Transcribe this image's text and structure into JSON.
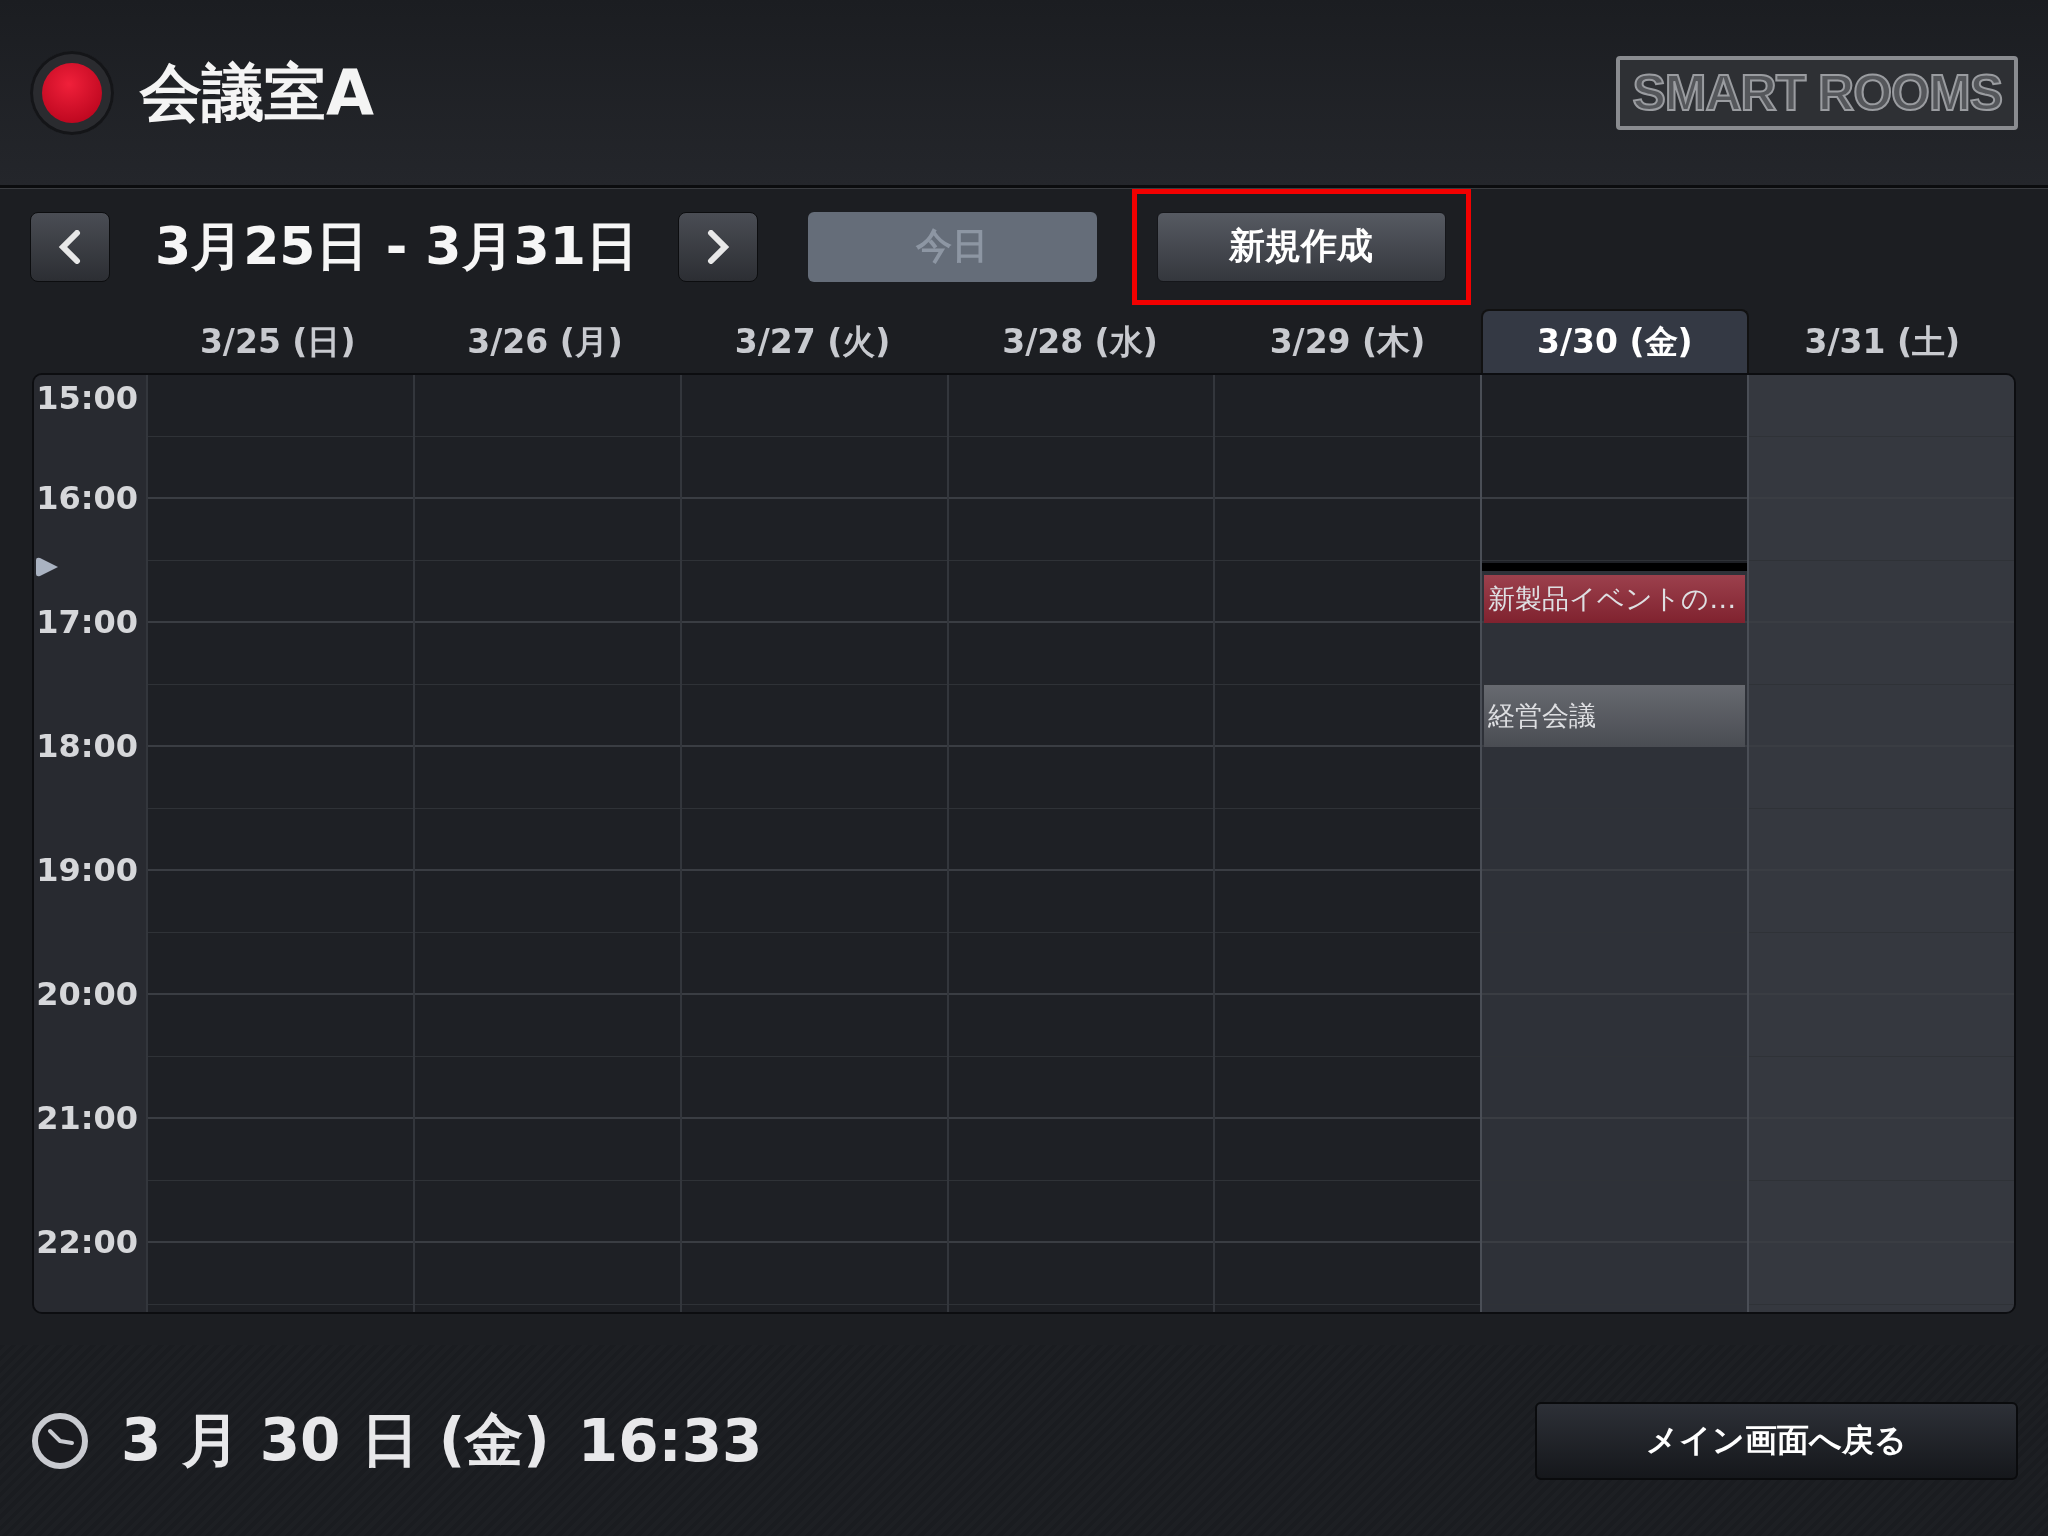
{
  "header": {
    "room_name": "会議室A",
    "logo": "SMART ROOMS"
  },
  "nav": {
    "range": "3月25日 - 3月31日",
    "today_button": {
      "label": "今日",
      "disabled": true
    },
    "new_button": {
      "label": "新規作成",
      "highlighted": true
    }
  },
  "days": [
    {
      "label": "3/25 (日)",
      "selected": false,
      "past": true
    },
    {
      "label": "3/26 (月)",
      "selected": false,
      "past": true
    },
    {
      "label": "3/27 (火)",
      "selected": false,
      "past": true
    },
    {
      "label": "3/28 (水)",
      "selected": false,
      "past": true
    },
    {
      "label": "3/29 (木)",
      "selected": false,
      "past": true
    },
    {
      "label": "3/30 (金)",
      "selected": true,
      "past": false,
      "events": [
        {
          "title": "新製品イベントの…",
          "color": "#8e2634"
        },
        {
          "title": "経営会議",
          "color": "#52555c"
        }
      ]
    },
    {
      "label": "3/31 (土)",
      "selected": false,
      "past": false
    }
  ],
  "hours": [
    "15:00",
    "16:00",
    "17:00",
    "18:00",
    "19:00",
    "20:00",
    "21:00",
    "22:00"
  ],
  "footer": {
    "date": "3 月 30 日 (金)",
    "time": "16:33",
    "back_button": "メイン画面へ戻る"
  }
}
